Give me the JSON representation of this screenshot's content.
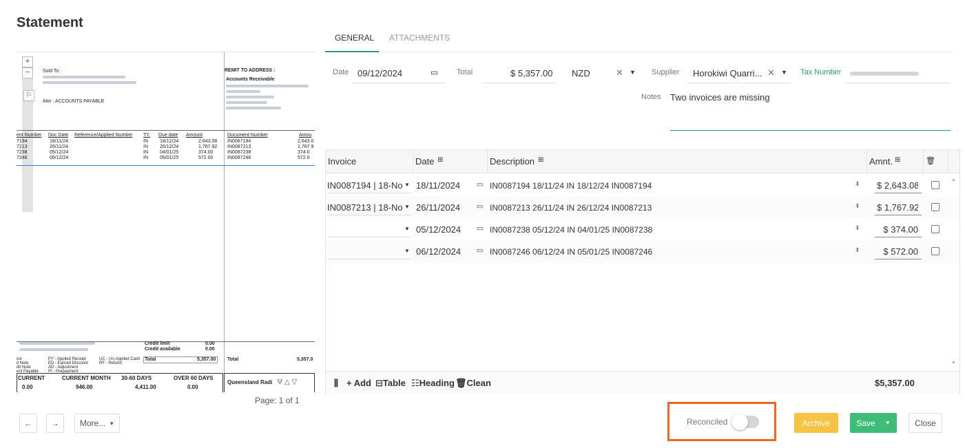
{
  "page_title": "Statement",
  "pdf": {
    "sold_to": "Sold To :",
    "attn": "Attn : ACCOUNTS PAYABLE",
    "remit_to": "REMIT TO ADDRESS :",
    "accounts_receivable": "Accounts Receivable",
    "columns": [
      "ent Number",
      "Doc Date",
      "Reference/Applied Number",
      "TY.",
      "Due date",
      "Amount",
      "Document Number",
      "Amou"
    ],
    "rows": [
      {
        "num": "7194",
        "date": "18/11/24",
        "ty": "IN",
        "due": "18/12/24",
        "amount": "2,643.08",
        "doc": "IN0087194",
        "amt2": "2,643.0"
      },
      {
        "num": "7213",
        "date": "26/11/24",
        "ty": "IN",
        "due": "26/12/24",
        "amount": "1,767.92",
        "doc": "IN0087213",
        "amt2": "1,767.9"
      },
      {
        "num": "7238",
        "date": "05/12/24",
        "ty": "IN",
        "due": "04/01/25",
        "amount": "374.00",
        "doc": "IN0087238",
        "amt2": "374.0"
      },
      {
        "num": "7248",
        "date": "06/12/24",
        "ty": "IN",
        "due": "05/01/25",
        "amount": "572.00",
        "doc": "IN0087246",
        "amt2": "572.0"
      }
    ],
    "credit_limit_label": "Credit limit",
    "credit_limit": "0.00",
    "credit_available_label": "Credit available",
    "credit_available": "0.00",
    "total_label": "Total",
    "total_value": "5,357.00",
    "total_label_right": "Total",
    "total_value_right": "5,357.0",
    "legend": [
      "PY - Applied Receipt",
      "ED - Earned Discount",
      "AD - Adjustment",
      "PI - Prepayment",
      "UC - Un-Applied Cash",
      "RF - Refund"
    ],
    "legend_left": [
      "ice",
      "it Note",
      "dit Note",
      "ent Payable"
    ],
    "ageing_headers": [
      "CURRENT",
      "CURRENT MONTH",
      "30-60 DAYS",
      "OVER 60 DAYS"
    ],
    "ageing_values": [
      "0.00",
      "946.00",
      "4,411.00",
      "0.00"
    ],
    "footer_company": "Queensland Radi",
    "page_label": "Page: 1 of 1"
  },
  "nav": {
    "prev": "←",
    "next": "→",
    "more": "More..."
  },
  "tabs": [
    "GENERAL",
    "ATTACHMENTS"
  ],
  "form": {
    "date_label": "Date",
    "date_value": "09/12/2024",
    "total_label": "Total",
    "total_value": "$ 5,357.00",
    "currency": "NZD",
    "supplier_label": "Supplier",
    "supplier_value": "Horokiwi Quarri...",
    "tax_label": "Tax Number",
    "notes_label": "Notes",
    "notes_value": "Two invoices are missing"
  },
  "grid": {
    "headers": [
      "Invoice",
      "Date",
      "Description",
      "Amnt."
    ],
    "rows": [
      {
        "invoice": "IN0087194 | 18-No",
        "date": "18/11/2024",
        "description": "IN0087194 18/11/24 IN 18/12/24 IN0087194",
        "amount": "$ 2,643.08"
      },
      {
        "invoice": "IN0087213 | 18-No",
        "date": "26/11/2024",
        "description": "IN0087213 26/11/24 IN 26/12/24 IN0087213",
        "amount": "$ 1,767.92"
      },
      {
        "invoice": "",
        "date": "05/12/2024",
        "description": "IN0087238 05/12/24 IN 04/01/25 IN0087238",
        "amount": "$ 374.00"
      },
      {
        "invoice": "",
        "date": "06/12/2024",
        "description": "IN0087246 06/12/24 IN 05/01/25 IN0087246",
        "amount": "$ 572.00"
      }
    ],
    "footer": {
      "add": "+ Add",
      "table": "Table",
      "heading": "Heading",
      "clean": "Clean",
      "total": "$5,357.00"
    }
  },
  "actions": {
    "reconciled_label": "Reconciled",
    "reconciled_on": false,
    "archive": "Archive",
    "save": "Save",
    "close": "Close"
  },
  "colors": {
    "accent": "#2a9d6f",
    "archive": "#f6c344",
    "save": "#3dbd77",
    "highlight": "#f0641e"
  }
}
